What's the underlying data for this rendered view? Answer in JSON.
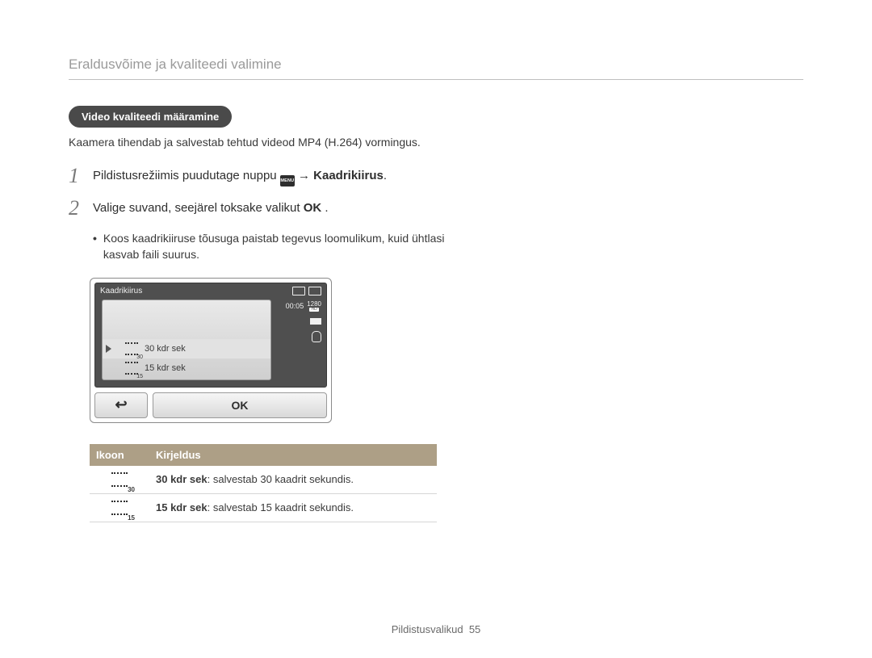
{
  "section_title": "Eraldusvõime ja kvaliteedi valimine",
  "pill": "Video kvaliteedi määramine",
  "intro": "Kaamera tihendab ja salvestab tehtud videod MP4 (H.264) vormingus.",
  "step1": {
    "pre": "Pildistusrežiimis puudutage nuppu ",
    "menu_label": "MENU",
    "arrow": " → ",
    "bold": "Kaadrikiirus",
    "post": "."
  },
  "step2": {
    "pre": "Valige suvand, seejärel toksake valikut ",
    "ok": "OK",
    "post": " ."
  },
  "bullet": "Koos kaadrikiiruse tõusuga paistab tegevus loomulikum, kuid ühtlasi kasvab faili suurus.",
  "lcd": {
    "title": "Kaadrikiirus",
    "time": "00:05",
    "res": "1280",
    "res_hd": "HD",
    "opt30": "30 kdr sek",
    "opt30_sub": "30",
    "opt15": "15 kdr sek",
    "opt15_sub": "15",
    "back": "↩",
    "ok": "OK"
  },
  "table": {
    "h1": "Ikoon",
    "h2": "Kirjeldus",
    "rows": [
      {
        "sub": "30",
        "bold": "30 kdr sek",
        "rest": ": salvestab 30 kaadrit sekundis."
      },
      {
        "sub": "15",
        "bold": "15 kdr sek",
        "rest": ": salvestab 15 kaadrit sekundis."
      }
    ]
  },
  "footer_label": "Pildistusvalikud",
  "footer_page": "55"
}
